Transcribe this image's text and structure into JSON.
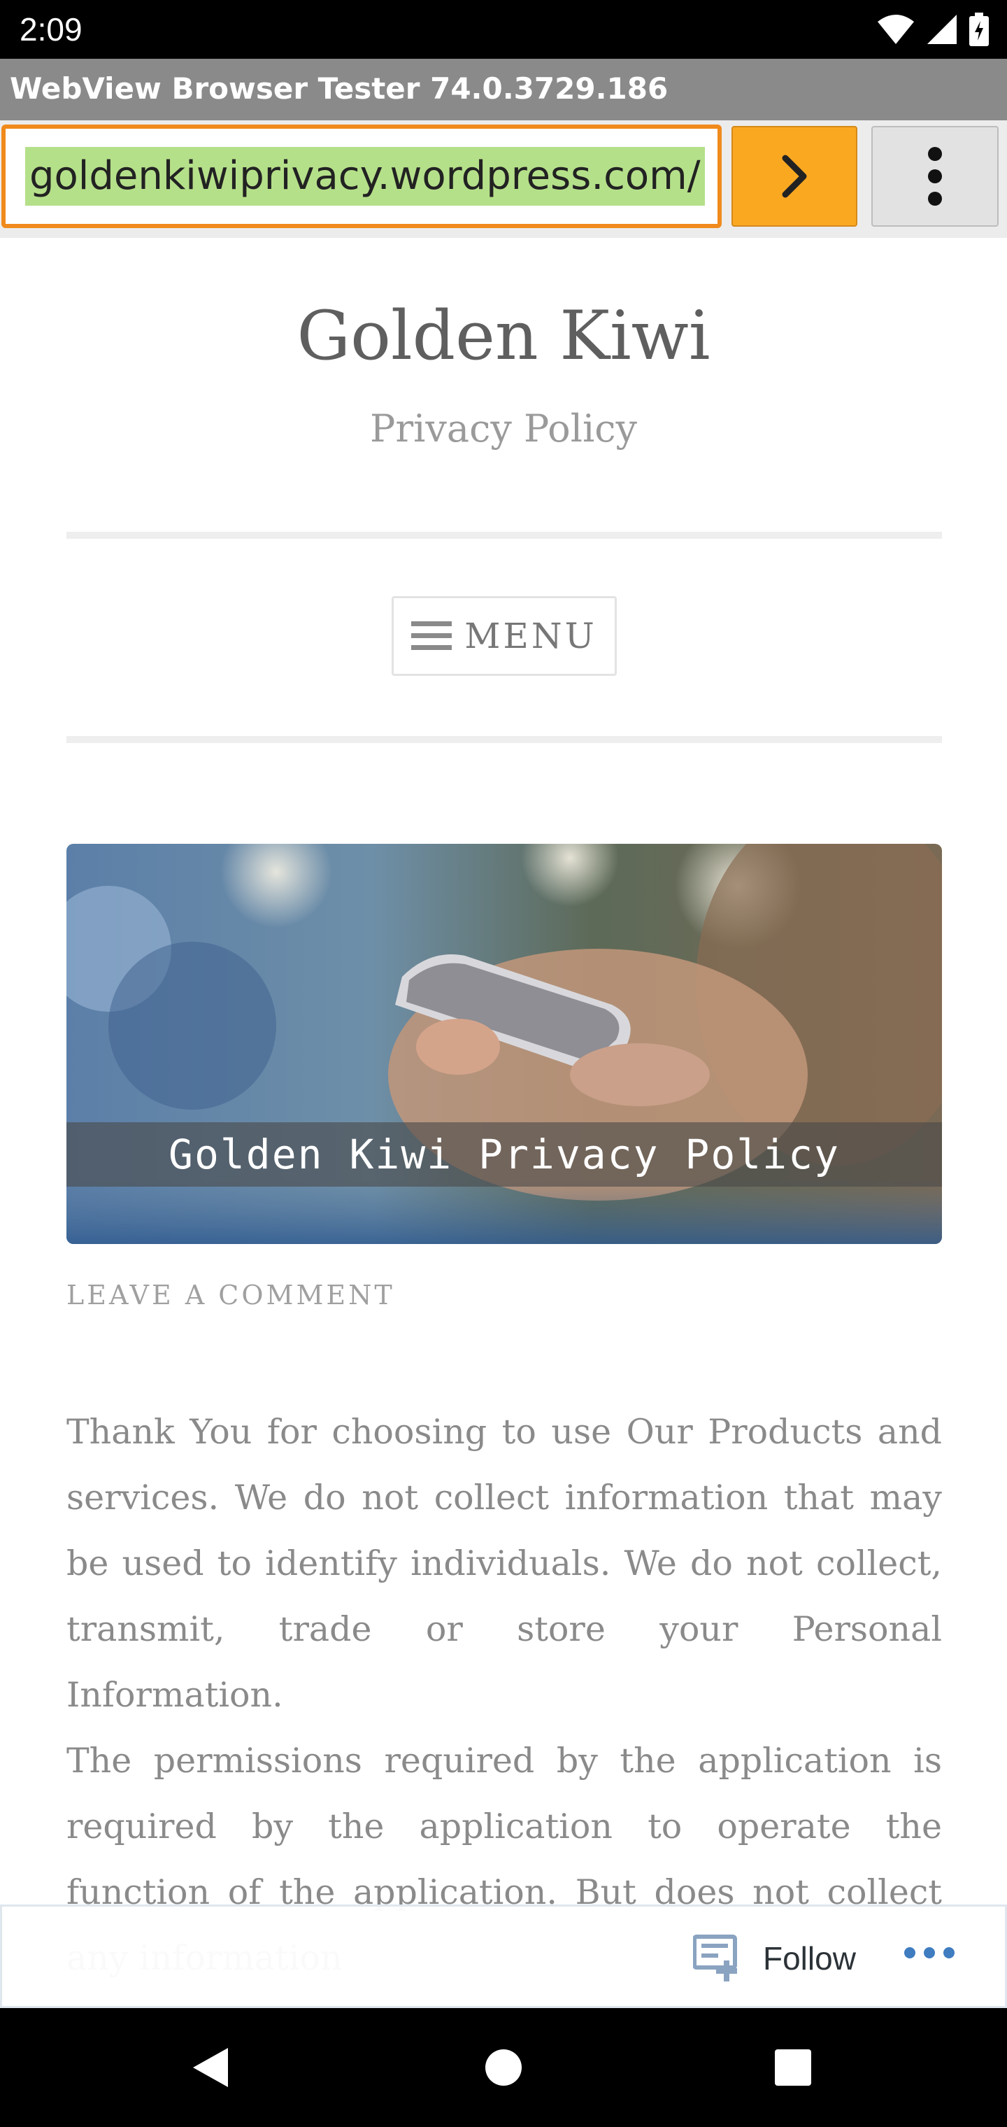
{
  "status_bar": {
    "time": "2:09",
    "icons": [
      "wifi-icon",
      "cellular-signal-icon",
      "battery-icon"
    ]
  },
  "app": {
    "title": "WebView Browser Tester 74.0.3729.186",
    "url_value": "goldenkiwiprivacy.wordpress.com/",
    "go_button": "chevron-right-icon",
    "overflow_menu": "more-vert-icon"
  },
  "site": {
    "title": "Golden Kiwi",
    "description": "Privacy Policy",
    "menu_label": "MENU"
  },
  "post": {
    "featured_image_caption": "Golden Kiwi Privacy Policy",
    "leave_comment": "LEAVE A COMMENT",
    "paragraphs": [
      "Thank You for choosing to use Our Products and services. We do not collect information that may be used to identify individuals. We do not collect, transmit, trade or store your Personal Information.",
      "The permissions required by the application is required by the application to operate the function of the application. But does not collect any information"
    ]
  },
  "follow_bar": {
    "follow_label": "Follow"
  },
  "colors": {
    "url_border": "#f08a1c",
    "url_highlight": "#b5e08a",
    "go_button": "#fba821",
    "follow_accent": "#3f7cc0"
  }
}
